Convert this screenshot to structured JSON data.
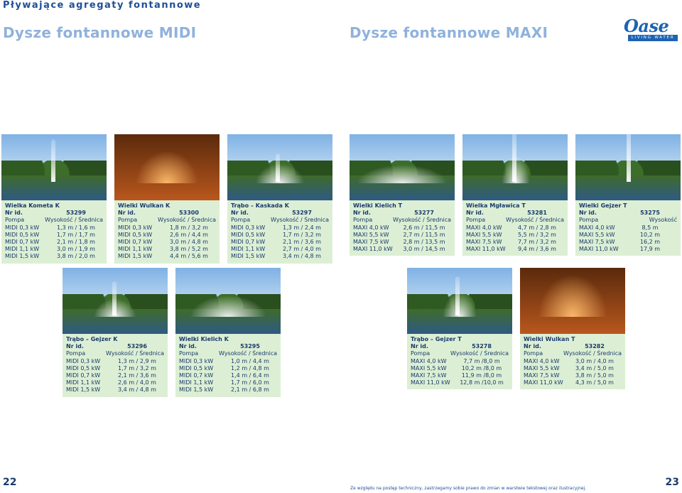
{
  "header": {
    "section_title": "Pływające agregaty fontannowe",
    "midi_title": "Dysze fontannowe MIDI",
    "maxi_title": "Dysze fontannowe MAXI"
  },
  "logo": {
    "name": "Oase",
    "tagline": "LIVING WATER",
    "color": "#1d63b4"
  },
  "colors": {
    "card_bg": "#dcefd4",
    "text": "#1a3a6b",
    "heading_light": "#8fb2dc"
  },
  "cards": [
    {
      "name": "Wielka Kometa K",
      "id_label": "Nr id.",
      "id": "53299",
      "col1": "Pompa",
      "col2": "Wysokość / Średnica",
      "rows": [
        [
          "MIDI 0,3 kW",
          "1,3 m / 1,6 m"
        ],
        [
          "MIDI 0,5 kW",
          "1,7 m / 1,7 m"
        ],
        [
          "MIDI 0,7 kW",
          "2,1 m / 1,8 m"
        ],
        [
          "MIDI 1,1 kW",
          "3,0 m / 1,9 m"
        ],
        [
          "MIDI 1,5 kW",
          "3,8 m / 2,0 m"
        ]
      ]
    },
    {
      "name": "Wielki Wulkan K",
      "id_label": "Nr id.",
      "id": "53300",
      "col1": "Pompa",
      "col2": "Wysokość / Średnica",
      "rows": [
        [
          "MIDI 0,3 kW",
          "1,8 m / 3,2 m"
        ],
        [
          "MIDI 0,5 kW",
          "2,6 m / 4,4 m"
        ],
        [
          "MIDI 0,7 kW",
          "3,0 m / 4,8 m"
        ],
        [
          "MIDI 1,1 kW",
          "3,8 m / 5,2 m"
        ],
        [
          "MIDI 1,5 kW",
          "4,4 m / 5,6 m"
        ]
      ]
    },
    {
      "name": "Trąbo – Kaskada K",
      "id_label": "Nr id.",
      "id": "53297",
      "col1": "Pompa",
      "col2": "Wysokość / Średnica",
      "rows": [
        [
          "MIDI 0,3 kW",
          "1,3 m / 2,4 m"
        ],
        [
          "MIDI 0,5 kW",
          "1,7 m / 3,2 m"
        ],
        [
          "MIDI 0,7 kW",
          "2,1 m / 3,6 m"
        ],
        [
          "MIDI 1,1 kW",
          "2,7 m / 4,0 m"
        ],
        [
          "MIDI 1,5 kW",
          "3,4 m / 4,8 m"
        ]
      ]
    },
    {
      "name": "Wielki Kielich T",
      "id_label": "Nr id.",
      "id": "53277",
      "col1": "Pompa",
      "col2": "Wysokość / Średnica",
      "rows": [
        [
          "MAXI 4,0 kW",
          "2,6 m / 11,5 m"
        ],
        [
          "MAXI 5,5 kW",
          "2,7 m / 11,5 m"
        ],
        [
          "MAXI 7,5 kW",
          "2,8 m / 13,5 m"
        ],
        [
          "MAXI 11,0 kW",
          "3,0 m / 14,5 m"
        ]
      ]
    },
    {
      "name": "Wielka Mgławica T",
      "id_label": "Nr id.",
      "id": "53281",
      "col1": "Pompa",
      "col2": "Wysokość / Średnica",
      "rows": [
        [
          "MAXI 4,0 kW",
          "4,7 m / 2,8 m"
        ],
        [
          "MAXI 5,5 kW",
          "5,5 m / 3,2 m"
        ],
        [
          "MAXI 7,5 kW",
          "7,7 m / 3,2 m"
        ],
        [
          "MAXI 11,0 kW",
          "9,4 m / 3,6 m"
        ]
      ]
    },
    {
      "name": "Wielki Gejzer T",
      "id_label": "Nr id.",
      "id": "53275",
      "col1": "Pompa",
      "col2": "Wysokość",
      "rows": [
        [
          "MAXI 4,0 kW",
          "8,5 m"
        ],
        [
          "MAXI 5,5 kW",
          "10,2 m"
        ],
        [
          "MAXI 7,5 kW",
          "16,2 m"
        ],
        [
          "MAXI 11,0 kW",
          "17,9 m"
        ]
      ]
    },
    {
      "name": "Trąbo – Gejzer K",
      "id_label": "Nr id.",
      "id": "53296",
      "col1": "Pompa",
      "col2": "Wysokość / Średnica",
      "rows": [
        [
          "MIDI 0,3 kW",
          "1,3 m / 2,9 m"
        ],
        [
          "MIDI 0,5 kW",
          "1,7 m / 3,2 m"
        ],
        [
          "MIDI 0,7 kW",
          "2,1 m / 3,6 m"
        ],
        [
          "MIDI 1,1 kW",
          "2,6 m / 4,0 m"
        ],
        [
          "MIDI 1,5 kW",
          "3,4 m / 4,8 m"
        ]
      ]
    },
    {
      "name": "Wielki Kielich K",
      "id_label": "Nr id.",
      "id": "53295",
      "col1": "Pompa",
      "col2": "Wysokość / Średnica",
      "rows": [
        [
          "MIDI 0,3 kW",
          "1,0 m / 4,4 m"
        ],
        [
          "MIDI 0,5 kW",
          "1,2 m / 4,8 m"
        ],
        [
          "MIDI 0,7 kW",
          "1,4 m / 6,4 m"
        ],
        [
          "MIDI 1,1 kW",
          "1,7 m / 6,0 m"
        ],
        [
          "MIDI 1,5 kW",
          "2,1 m / 6,8 m"
        ]
      ]
    },
    {
      "name": "Trąbo – Gejzer T",
      "id_label": "Nr id.",
      "id": "53278",
      "col1": "Pompa",
      "col2": "Wysokość / Średnica",
      "rows": [
        [
          "MAXI 4,0 kW",
          "7,7 m /8,0 m"
        ],
        [
          "MAXI 5,5 kW",
          "10,2 m /8,0 m"
        ],
        [
          "MAXI 7,5 kW",
          "11,9 m /8,0 m"
        ],
        [
          "MAXI 11,0 kW",
          "12,8 m /10,0 m"
        ]
      ]
    },
    {
      "name": "Wielki Wulkan T",
      "id_label": "Nr id.",
      "id": "53282",
      "col1": "Pompa",
      "col2": "Wysokość / Średnica",
      "rows": [
        [
          "MAXI 4,0 kW",
          "3,0 m / 4,0 m"
        ],
        [
          "MAXI 5,5 kW",
          "3,4 m / 5,0 m"
        ],
        [
          "MAXI 7,5 kW",
          "3,8 m / 5,0 m"
        ],
        [
          "MAXI 11,0 kW",
          "4,3 m / 5,0 m"
        ]
      ]
    }
  ],
  "footer": {
    "page_left": "22",
    "page_right": "23",
    "note": "Ze względu na postęp techniczny, zastrzegamy sobie prawo do zmian w warstwie tekstowej oraz ilustracyjnej."
  }
}
